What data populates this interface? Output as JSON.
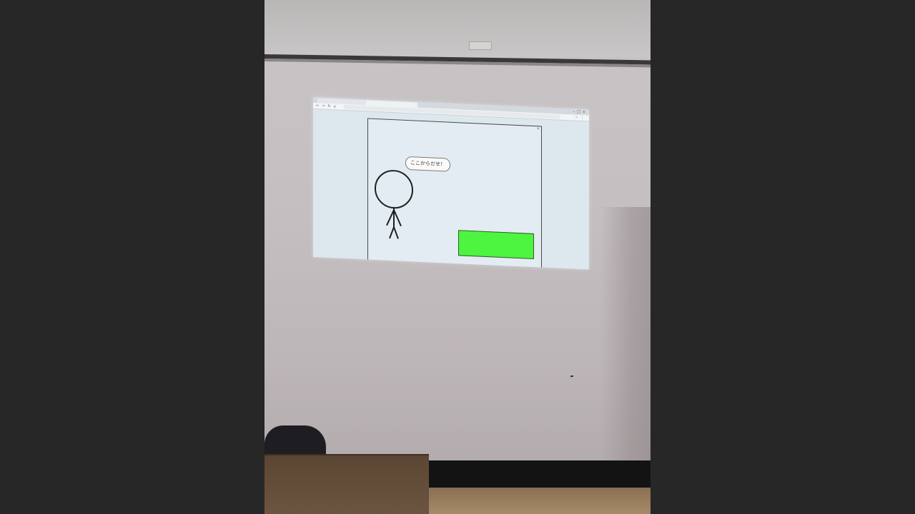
{
  "browser": {
    "tabs": [
      {
        "label": ""
      },
      {
        "label": ""
      }
    ],
    "url": ""
  },
  "game": {
    "speech_bubble": "ここからだせ！"
  },
  "colors": {
    "box_fill": "#4df540",
    "stage_bg": "#e3ecf2",
    "room_wall": "#c4bfc1"
  },
  "icons": [
    "back-arrow-icon",
    "forward-arrow-icon",
    "reload-icon",
    "home-icon",
    "close-icon",
    "minimize-icon",
    "maximize-icon",
    "extension-icon"
  ]
}
